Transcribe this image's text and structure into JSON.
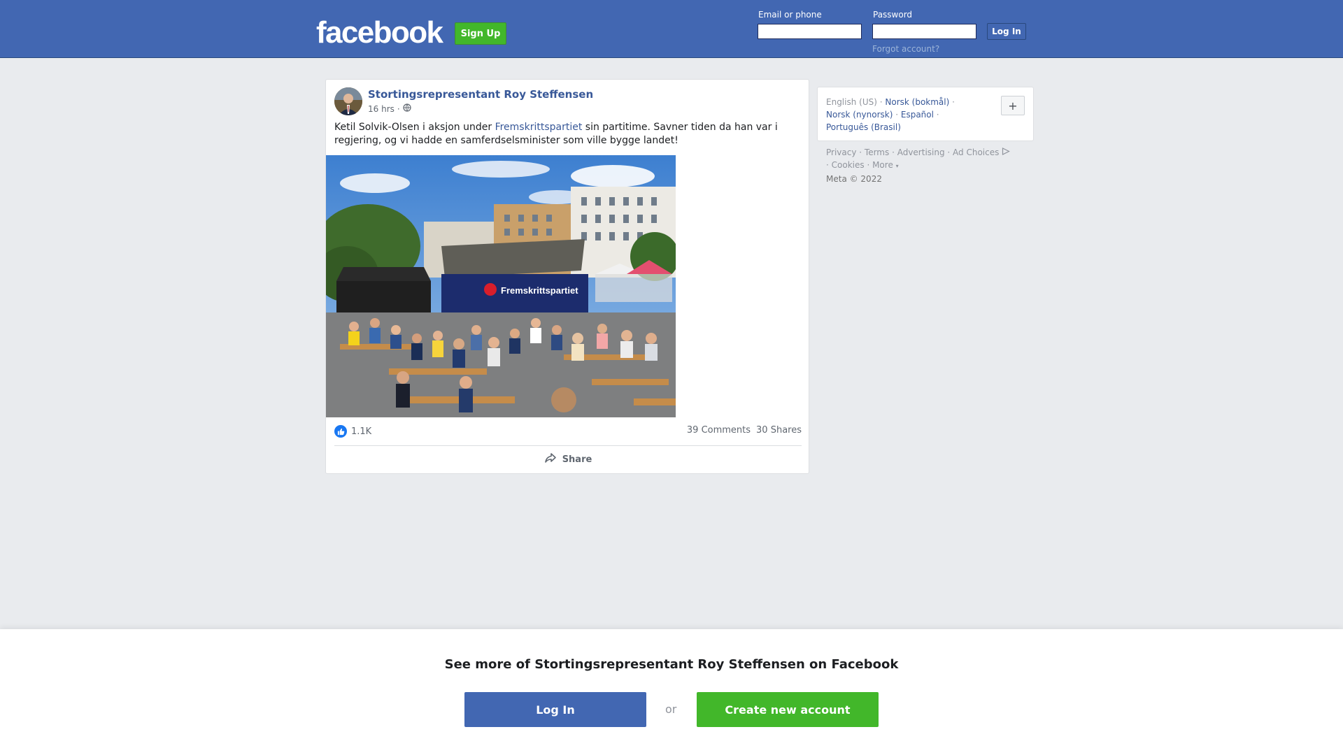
{
  "header": {
    "logo": "facebook",
    "signup_label": "Sign Up",
    "email_label": "Email or phone",
    "password_label": "Password",
    "login_label": "Log In",
    "forgot_label": "Forgot account?"
  },
  "post": {
    "author": "Stortingsrepresentant Roy Steffensen",
    "time": "16 hrs",
    "text_before": "Ketil Solvik-Olsen i aksjon under ",
    "text_link": "Fremskrittspartiet",
    "text_after": " sin partitime. Savner tiden da han var i regjering, og vi hadde en samferdselsminister som ville bygge landet!",
    "likes": "1.1K",
    "comments": "39 Comments",
    "shares": "30 Shares",
    "share_label": "Share",
    "photo_banner_text": "Fremskrittspartiet"
  },
  "sidebar": {
    "languages": [
      "English (US)",
      "Norsk (bokmål)",
      "Norsk (nynorsk)",
      "Español",
      "Português (Brasil)"
    ],
    "plus_label": "+",
    "footer_links": [
      "Privacy",
      "Terms",
      "Advertising",
      "Ad Choices",
      "Cookies",
      "More"
    ],
    "copyright": "Meta © 2022"
  },
  "banner": {
    "title": "See more of Stortingsrepresentant Roy Steffensen on Facebook",
    "login_label": "Log In",
    "or_label": "or",
    "create_label": "Create new account"
  },
  "colors": {
    "brand_blue": "#4267b2",
    "link_blue": "#385898",
    "green": "#42b72a"
  }
}
